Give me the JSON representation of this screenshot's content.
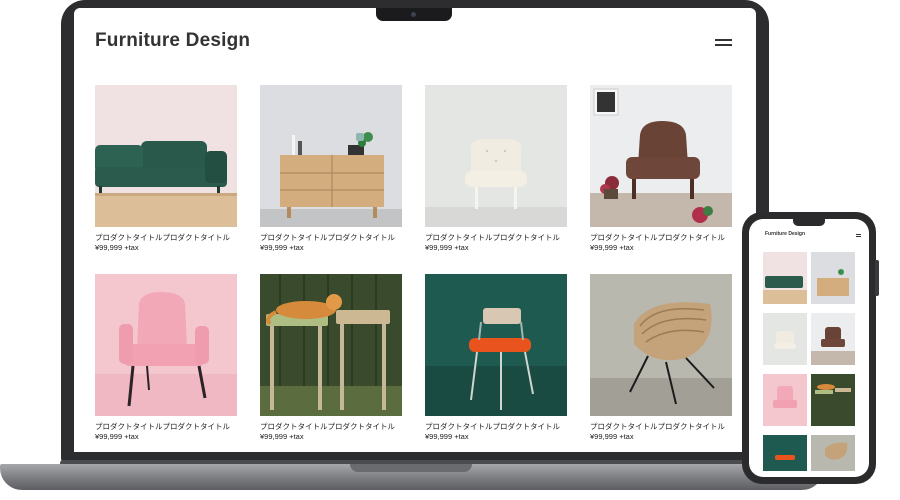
{
  "site": {
    "title": "Furniture Design"
  },
  "products": [
    {
      "title": "プロダクトタイトルプロダクトタイトル",
      "price": "¥99,999 +tax",
      "image": "green-velvet-sofa"
    },
    {
      "title": "プロダクトタイトルプロダクトタイトル",
      "price": "¥99,999 +tax",
      "image": "wooden-sideboard"
    },
    {
      "title": "プロダクトタイトルプロダクトタイトル",
      "price": "¥99,999 +tax",
      "image": "white-tufted-chair"
    },
    {
      "title": "プロダクトタイトルプロダクトタイトル",
      "price": "¥99,999 +tax",
      "image": "brown-armchair"
    },
    {
      "title": "プロダクトタイトルプロダクトタイトル",
      "price": "¥99,999 +tax",
      "image": "pink-armchair"
    },
    {
      "title": "プロダクトタイトルプロダクトタイトル",
      "price": "¥99,999 +tax",
      "image": "cat-on-stools"
    },
    {
      "title": "プロダクトタイトルプロダクトタイトル",
      "price": "¥99,999 +tax",
      "image": "orange-chair"
    },
    {
      "title": "プロダクトタイトルプロダクトタイトル",
      "price": "¥99,999 +tax",
      "image": "rattan-chair"
    }
  ],
  "mobile": {
    "title": "Furniture Design"
  },
  "icons": {
    "menu": "hamburger-menu-icon"
  }
}
